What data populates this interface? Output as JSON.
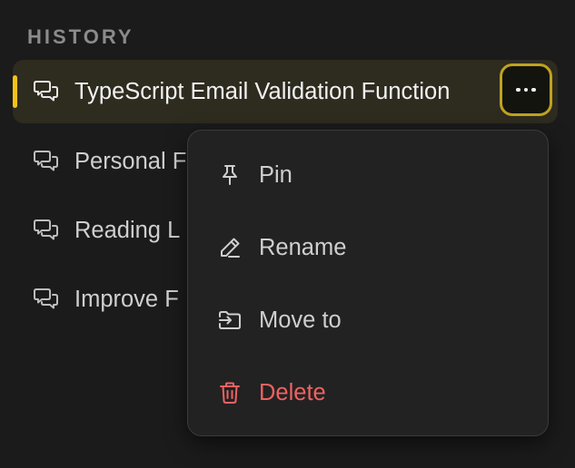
{
  "history": {
    "title": "HISTORY",
    "items": [
      {
        "label": "TypeScript Email Validation Function",
        "icon": "chat-bubbles-icon",
        "active": true
      },
      {
        "label": "Personal F",
        "icon": "chat-bubbles-icon",
        "active": false
      },
      {
        "label": "Reading L",
        "icon": "chat-bubbles-icon",
        "active": false
      },
      {
        "label": "Improve F",
        "icon": "chat-bubbles-icon",
        "active": false
      }
    ],
    "more_icon": "more-horizontal-icon"
  },
  "context_menu": {
    "items": [
      {
        "label": "Pin",
        "icon": "pin-icon"
      },
      {
        "label": "Rename",
        "icon": "pencil-icon"
      },
      {
        "label": "Move to",
        "icon": "move-to-folder-icon"
      },
      {
        "label": "Delete",
        "icon": "trash-icon",
        "danger": true
      }
    ]
  },
  "colors": {
    "background": "#1b1b1b",
    "active_row": "#2e2b1f",
    "accent": "#f4c21b",
    "focus_ring": "#bfa221",
    "menu_background": "#222222",
    "danger": "#ef6262",
    "text": "#cfcfcf",
    "muted": "#8b8b8b"
  }
}
